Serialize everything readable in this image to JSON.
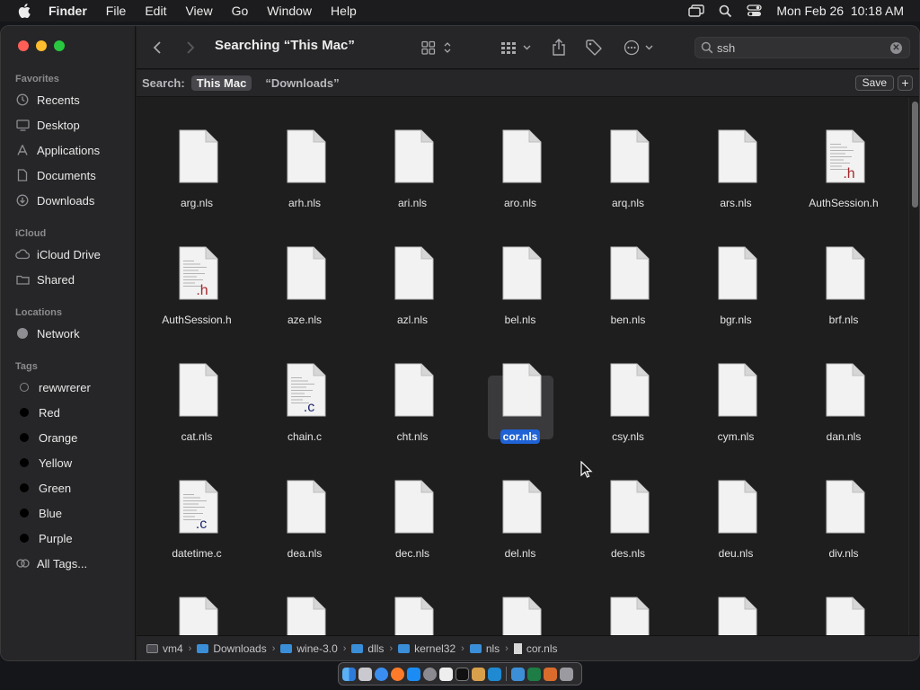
{
  "menubar": {
    "app_name": "Finder",
    "menus": [
      "File",
      "Edit",
      "View",
      "Go",
      "Window",
      "Help"
    ],
    "datetime": "Mon Feb 26  10:18 AM"
  },
  "sidebar": {
    "favorites_title": "Favorites",
    "favorites": [
      {
        "label": "Recents",
        "icon": "clock-icon"
      },
      {
        "label": "Desktop",
        "icon": "desktop-icon"
      },
      {
        "label": "Applications",
        "icon": "applications-icon"
      },
      {
        "label": "Documents",
        "icon": "document-icon"
      },
      {
        "label": "Downloads",
        "icon": "download-icon"
      }
    ],
    "icloud_title": "iCloud",
    "icloud": [
      {
        "label": "iCloud Drive",
        "icon": "cloud-icon"
      },
      {
        "label": "Shared",
        "icon": "shared-folder-icon"
      }
    ],
    "locations_title": "Locations",
    "locations": [
      {
        "label": "Network",
        "icon": "network-icon"
      }
    ],
    "tags_title": "Tags",
    "tags": [
      "rewwrerer",
      "Red",
      "Orange",
      "Yellow",
      "Green",
      "Blue",
      "Purple"
    ],
    "all_tags": "All Tags..."
  },
  "toolbar": {
    "title": "Searching “This Mac”",
    "search_value": "ssh"
  },
  "scopebar": {
    "label": "Search:",
    "active_scope": "This Mac",
    "other_scope": "“Downloads”",
    "save_label": "Save",
    "add_label": "+"
  },
  "files": [
    {
      "name": "arg.nls",
      "type": "blank"
    },
    {
      "name": "arh.nls",
      "type": "blank"
    },
    {
      "name": "ari.nls",
      "type": "blank"
    },
    {
      "name": "aro.nls",
      "type": "blank"
    },
    {
      "name": "arq.nls",
      "type": "blank"
    },
    {
      "name": "ars.nls",
      "type": "blank"
    },
    {
      "name": "AuthSession.h",
      "type": "h"
    },
    {
      "name": "AuthSession.h",
      "type": "h"
    },
    {
      "name": "aze.nls",
      "type": "blank"
    },
    {
      "name": "azl.nls",
      "type": "blank"
    },
    {
      "name": "bel.nls",
      "type": "blank"
    },
    {
      "name": "ben.nls",
      "type": "blank"
    },
    {
      "name": "bgr.nls",
      "type": "blank"
    },
    {
      "name": "brf.nls",
      "type": "blank"
    },
    {
      "name": "cat.nls",
      "type": "blank"
    },
    {
      "name": "chain.c",
      "type": "c"
    },
    {
      "name": "cht.nls",
      "type": "blank"
    },
    {
      "name": "cor.nls",
      "type": "blank",
      "selected": true
    },
    {
      "name": "csy.nls",
      "type": "blank"
    },
    {
      "name": "cym.nls",
      "type": "blank"
    },
    {
      "name": "dan.nls",
      "type": "blank"
    },
    {
      "name": "datetime.c",
      "type": "c"
    },
    {
      "name": "dea.nls",
      "type": "blank"
    },
    {
      "name": "dec.nls",
      "type": "blank"
    },
    {
      "name": "del.nls",
      "type": "blank"
    },
    {
      "name": "des.nls",
      "type": "blank"
    },
    {
      "name": "deu.nls",
      "type": "blank"
    },
    {
      "name": "div.nls",
      "type": "blank"
    },
    {
      "name": "",
      "type": "blank"
    },
    {
      "name": "",
      "type": "blank"
    },
    {
      "name": "",
      "type": "blank"
    },
    {
      "name": "",
      "type": "blank"
    },
    {
      "name": "",
      "type": "blank"
    },
    {
      "name": "",
      "type": "blank"
    },
    {
      "name": "",
      "type": "blank"
    }
  ],
  "pathbar": [
    "vm4",
    "Downloads",
    "wine-3.0",
    "dlls",
    "kernel32",
    "nls",
    "cor.nls"
  ],
  "colors": {
    "selection": "#1f63d6",
    "tag_red": "#ff453a",
    "h_ext": "#a5282c",
    "c_ext": "#1f2a6e"
  }
}
